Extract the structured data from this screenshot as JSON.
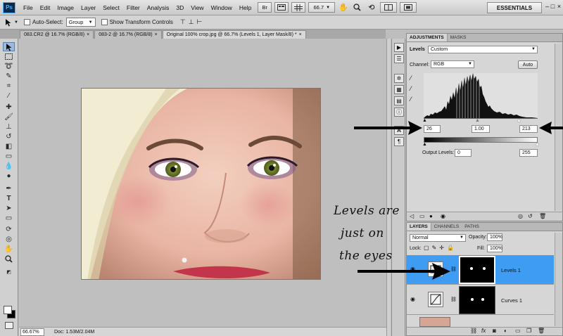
{
  "app": {
    "logo": "Ps",
    "menu": [
      "File",
      "Edit",
      "Image",
      "Layer",
      "Select",
      "Filter",
      "Analysis",
      "3D",
      "View",
      "Window",
      "Help"
    ],
    "bridge_button": "Br",
    "zoom_select": "66.7",
    "workspace": "ESSENTIALS",
    "window_controls": [
      "–",
      "□",
      "×"
    ]
  },
  "options_bar": {
    "auto_select_label": "Auto-Select:",
    "auto_select_value": "Group",
    "show_transform_label": "Show Transform Controls"
  },
  "document_tabs": [
    {
      "label": "083.CR2 @ 16.7% (RGB/8)",
      "close": "×",
      "active": false
    },
    {
      "label": "083-2 @ 16.7% (RGB/8)",
      "close": "×",
      "active": false
    },
    {
      "label": "Original 100% crop.jpg @ 66.7% (Levels 1, Layer Mask/8) *",
      "close": "×",
      "active": true
    }
  ],
  "status_bar": {
    "zoom": "66.67%",
    "doc_size": "Doc: 1.53M/2.04M"
  },
  "adjustments_panel": {
    "tabs": [
      "ADJUSTMENTS",
      "MASKS"
    ],
    "adjustment_name": "Levels",
    "preset_value": "Custom",
    "channel_label": "Channel:",
    "channel_value": "RGB",
    "auto_button": "Auto",
    "input_black": "26",
    "input_gamma": "1.00",
    "input_white": "213",
    "output_label": "Output Levels:",
    "output_black": "0",
    "output_white": "255"
  },
  "layers_panel": {
    "tabs": [
      "LAYERS",
      "CHANNELS",
      "PATHS"
    ],
    "blend_mode": "Normal",
    "opacity_label": "Opacity:",
    "opacity_value": "100%",
    "lock_label": "Lock:",
    "fill_label": "Fill:",
    "fill_value": "100%",
    "layers": [
      {
        "name": "Levels 1",
        "selected": true
      },
      {
        "name": "Curves 1",
        "selected": false
      }
    ]
  },
  "annotations": {
    "line1": "Levels are",
    "line2": "just on",
    "line3": "the eyes"
  },
  "colors": {
    "selection_blue": "#3e9cf2",
    "panel_gray": "#d6d6d6",
    "canvas_gray": "#bfbfbf"
  }
}
